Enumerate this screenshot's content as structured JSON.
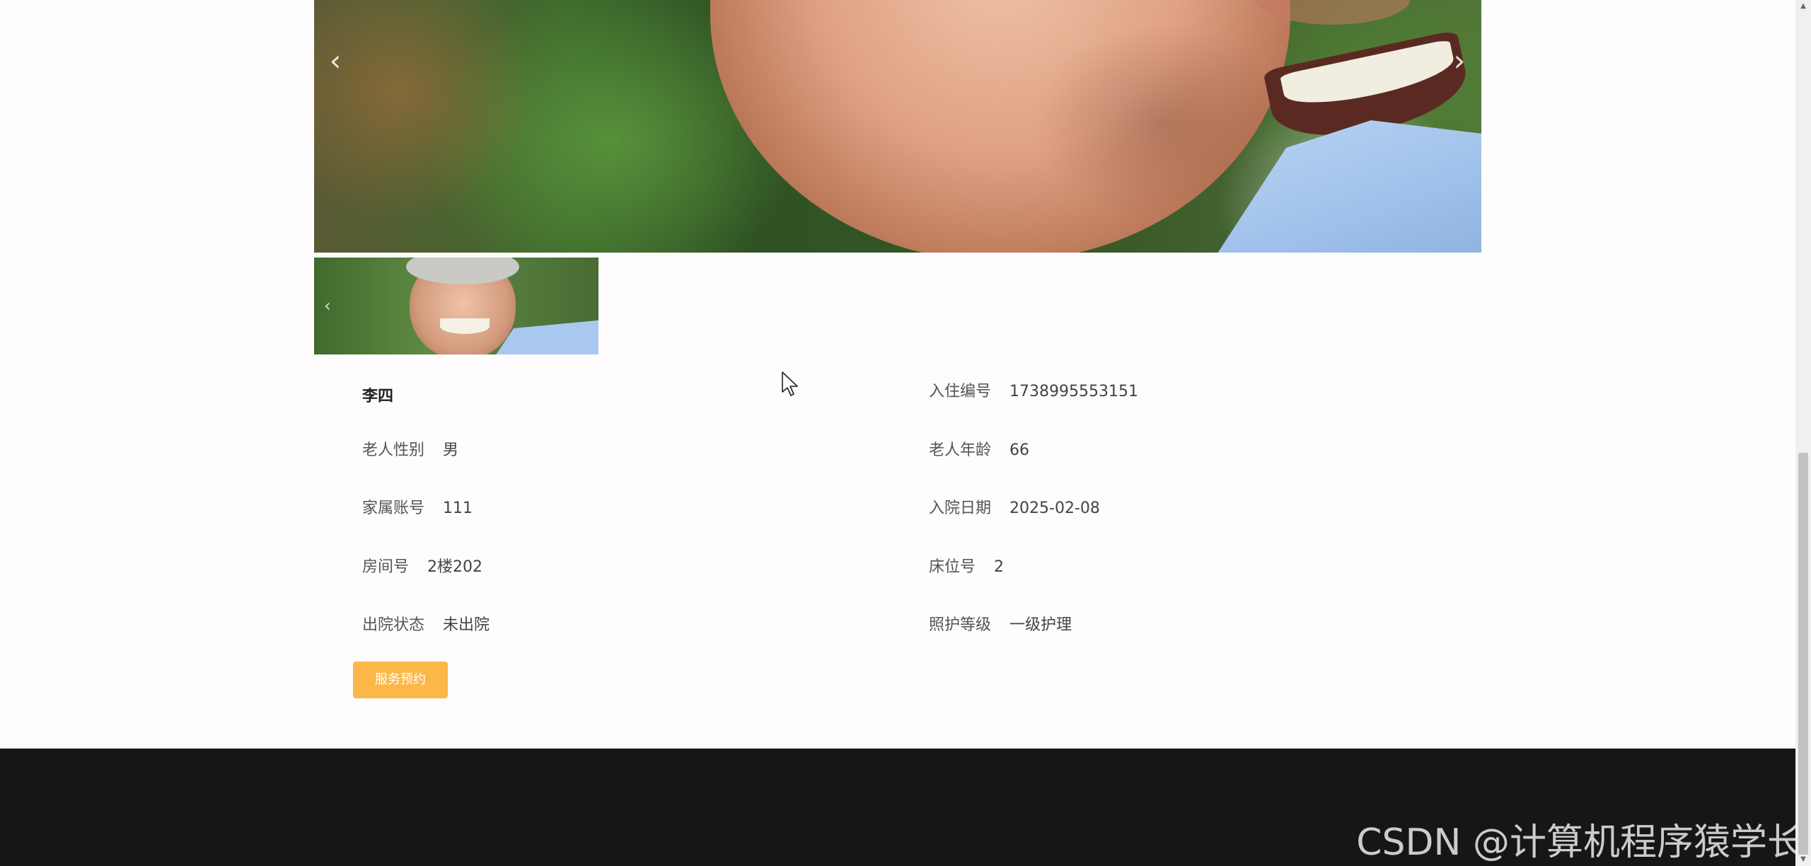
{
  "carousel": {
    "prev_icon": "chevron-left-icon",
    "next_icon": "chevron-right-icon",
    "prev_glyph": "‹",
    "next_glyph": "›"
  },
  "thumbnail": {
    "prev_glyph": "‹"
  },
  "elder": {
    "name": "李四",
    "fields": {
      "checkin_no": {
        "label": "入住编号",
        "value": "1738995553151"
      },
      "gender": {
        "label": "老人性别",
        "value": "男"
      },
      "age": {
        "label": "老人年龄",
        "value": "66"
      },
      "family_account": {
        "label": "家属账号",
        "value": "111"
      },
      "admit_date": {
        "label": "入院日期",
        "value": "2025-02-08"
      },
      "room_no": {
        "label": "房间号",
        "value": "2楼202"
      },
      "bed_no": {
        "label": "床位号",
        "value": "2"
      },
      "discharge_status": {
        "label": "出院状态",
        "value": "未出院"
      },
      "care_level": {
        "label": "照护等级",
        "value": "一级护理"
      }
    }
  },
  "actions": {
    "book_service": "服务预约"
  },
  "watermark": "CSDN @计算机程序猿学长",
  "colors": {
    "accent_button": "#fbb74a",
    "footer_bg": "#181516",
    "page_bg": "#fefcfc"
  }
}
